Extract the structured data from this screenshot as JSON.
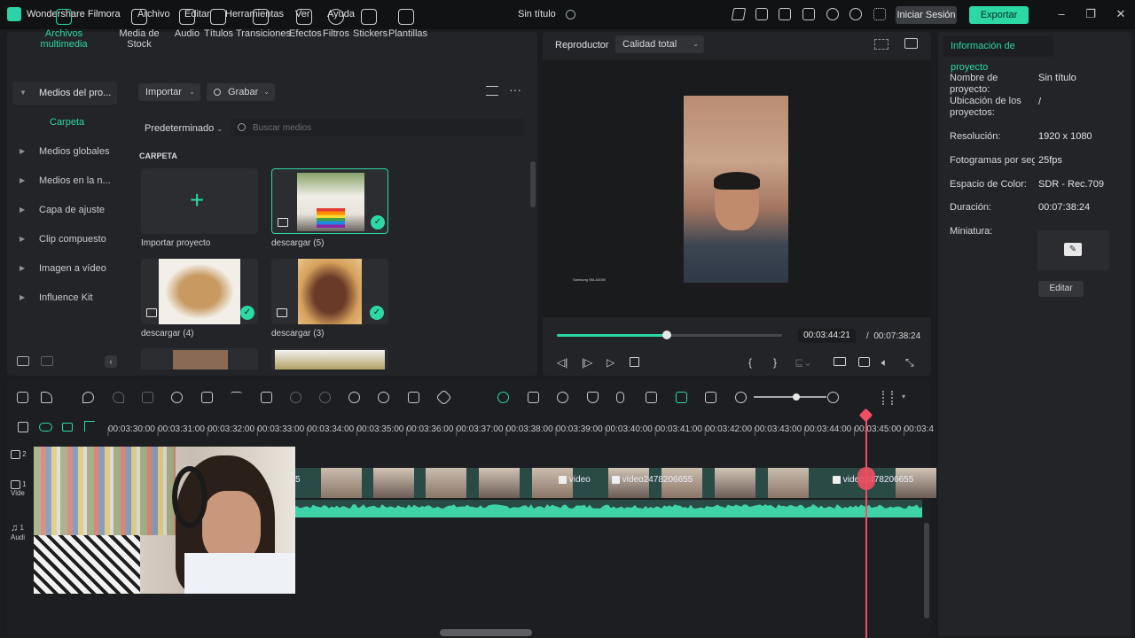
{
  "app": {
    "name": "Wondershare Filmora",
    "doc_title": "Sin título"
  },
  "menu": [
    "Archivo",
    "Editar",
    "Herramientas",
    "Ver",
    "Ayuda"
  ],
  "titlebar": {
    "login_label": "Iniciar Sesión",
    "export_label": "Exportar"
  },
  "media_tabs": [
    "Archivos multimedia",
    "Media de Stock",
    "Audio",
    "Títulos",
    "Transiciones",
    "Efectos",
    "Filtros",
    "Stickers",
    "Plantillas"
  ],
  "media_sidebar": {
    "root": "Medios del pro...",
    "folder": "Carpeta",
    "items": [
      "Medios globales",
      "Medios en la n...",
      "Capa de ajuste",
      "Clip compuesto",
      "Imagen a vídeo",
      "Influence Kit"
    ]
  },
  "media_toolbar": {
    "import_label": "Importar",
    "record_label": "Grabar",
    "sort_label": "Predeterminado",
    "search_placeholder": "Buscar medios"
  },
  "folder_heading": "CARPETA",
  "media_items": [
    {
      "label": "Importar proyecto"
    },
    {
      "label": "descargar (5)"
    },
    {
      "label": "descargar (4)"
    },
    {
      "label": "descargar (3)"
    }
  ],
  "player": {
    "tab_label": "Reproductor",
    "quality_label": "Calidad total",
    "preview_caption": "Samsung SM-A3050",
    "progress": 0.49,
    "time_current": "00:03:44:21",
    "time_separator": "/",
    "time_total": "00:07:38:24"
  },
  "project_info": {
    "tab_label": "Información de proyecto",
    "fields": [
      {
        "key": "Nombre de proyecto:",
        "value": "Sin título"
      },
      {
        "key": "Ubicación de los proyectos:",
        "value": "/"
      },
      {
        "key": "Resolución:",
        "value": "1920 x 1080"
      },
      {
        "key": "Fotogramas por seg",
        "value": "25fps"
      },
      {
        "key": "Espacio de Color:",
        "value": "SDR - Rec.709"
      },
      {
        "key": "Duración:",
        "value": "00:07:38:24"
      },
      {
        "key": "Miniatura:",
        "value": ""
      }
    ],
    "edit_label": "Editar"
  },
  "timeline": {
    "ruler_labels": [
      "00:03:30:00",
      "00:03:31:00",
      "00:03:32:00",
      "00:03:33:00",
      "00:03:34:00",
      "00:03:35:00",
      "00:03:36:00",
      "00:03:37:00",
      "00:03:38:00",
      "00:03:39:00",
      "00:03:40:00",
      "00:03:41:00",
      "00:03:42:00",
      "00:03:43:00",
      "00:03:44:00",
      "00:03:45:00",
      "00:03:4"
    ],
    "tracks": [
      {
        "icon": "layers-icon",
        "number": "2",
        "label": ""
      },
      {
        "icon": "video-track-icon",
        "number": "1",
        "label": "Vide"
      },
      {
        "icon": "music-note-icon",
        "number": "1",
        "label": "Audi"
      }
    ],
    "clip_labels": [
      "5",
      "video",
      "video2478206655",
      "video2478206655"
    ]
  },
  "colors": {
    "accent": "#2bd8a6",
    "playhead": "#ef4e63",
    "panel": "#232427",
    "background": "#1b1c1f"
  }
}
